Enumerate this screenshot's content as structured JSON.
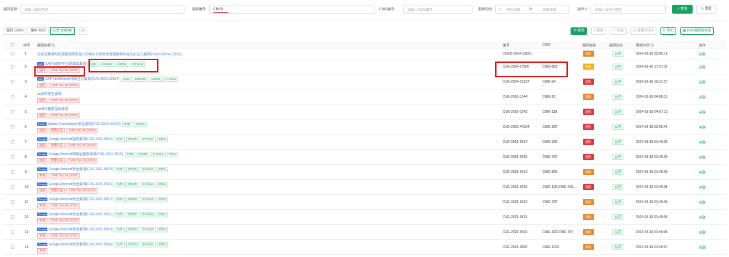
{
  "filters": {
    "name_label": "漏洞名称:",
    "name_placeholder": "请输入漏洞名称",
    "id_label": "漏洞编号:",
    "id_value": "CNVD",
    "cwe_label": "CWE编号:",
    "cwe_placeholder": "请输入CWE编号",
    "time_label": "更新时间:",
    "time_start": "开始日期",
    "time_to": "To",
    "time_end": "结束日期",
    "operator_label": "操作人:",
    "operator_placeholder": "请输入操作人姓名",
    "search_label": "查询",
    "reset_label": "重置"
  },
  "tabs": [
    {
      "label": "漏洞 13020"
    },
    {
      "label": "保存 3922"
    },
    {
      "label": "公开 264246"
    }
  ],
  "toolbar": {
    "add": "新增",
    "delete": "删除",
    "tag": "标签",
    "batch": "批量状态",
    "export": "导出",
    "import": "DPK漏洞库标签"
  },
  "columns": {
    "index": "序号",
    "name": "漏洞名称",
    "id": "编号",
    "cwe": "CWE",
    "level": "漏洞级别",
    "status": "漏洞状态",
    "time": "更新时间",
    "op": "操作"
  },
  "colors": {
    "high": "#e78a2c",
    "critical": "#d9363e",
    "medium": "#f0b416",
    "accent": "#19a15f"
  },
  "rows": [
    {
      "index": "1",
      "badge": "",
      "name": "北京亿赛通科技发展有限责任公司电子文档安全管理系统存在SQL注入漏洞(CNVD-2024-13551)",
      "sources": [],
      "tags": [],
      "id": "CNVD-2024-13551",
      "cwe": "",
      "level": "高危",
      "level_color": "high",
      "status": "公开",
      "time": "2024-03-16 23:00:15",
      "op": "关联"
    },
    {
      "index": "2",
      "badge": "SAP",
      "name": "SAP ABAP平台的跨站漏洞",
      "sources": [
        "CVE",
        "CNNVD",
        "CNVD",
        "X-Force"
      ],
      "tags": [
        "远程",
        "CWE Top 25 (2023)"
      ],
      "id": "CVE-2024-27900",
      "cwe": "CWE-862",
      "level": "中危",
      "level_color": "medium",
      "status": "公开",
      "time": "2024-03-16 17:31:35",
      "op": "关联"
    },
    {
      "index": "3",
      "badge": "SAP",
      "name": "SAP NetWeaver代码注入漏洞(CVE-2024-22127)",
      "sources": [
        "CVE",
        "CNNVD",
        "CNVD",
        "X-Force"
      ],
      "tags": [
        "远程",
        "CWE Top 25 (2023)"
      ],
      "id": "CVE-2024-22127",
      "cwe": "CWE-94",
      "level": "超危",
      "level_color": "critical",
      "status": "公开",
      "time": "2024-03-16 16:31:27",
      "op": "关联"
    },
    {
      "index": "4",
      "badge": "",
      "name": "unADF安全漏洞",
      "sources": [],
      "tags": [
        "远程",
        "CWE Top 25 (2023)"
      ],
      "id": "CVE-2016-1244",
      "cwe": "CWE-20",
      "level": "高危",
      "level_color": "high",
      "status": "公开",
      "time": "2024-03-16 04:08:11",
      "op": "关联"
    },
    {
      "index": "5",
      "badge": "",
      "name": "unADF整数溢出漏洞",
      "sources": [],
      "tags": [
        "远程",
        "CWE Top 25 (2023)"
      ],
      "id": "CVE-2016-1243",
      "cwe": "CWE-119",
      "level": "超危",
      "level_color": "critical",
      "status": "公开",
      "time": "2024-03-16 04:07:12",
      "op": "关联"
    },
    {
      "index": "6",
      "badge": "Adobe",
      "name": "Adobe FrameMaker安全漏洞(CVE-2023-44324)",
      "sources": [
        "CVE",
        "CNVD"
      ],
      "tags": [
        "远程",
        "无需认证",
        "CWE Top 25 (2023)"
      ],
      "id": "CVE-2023-44324",
      "cwe": "CWE-287",
      "level": "超危",
      "level_color": "critical",
      "status": "公开",
      "time": "2024-03-16 02:06:46",
      "op": "关联"
    },
    {
      "index": "7",
      "badge": "Google",
      "name": "Google Android提权漏洞(CVE-2021-0514)",
      "sources": [
        "CVE",
        "CNVD",
        "X-Force",
        "CISA"
      ],
      "tags": [
        "远程",
        "无需认证",
        "CWE Top 25 (2023)"
      ],
      "id": "CVE-2021-0514",
      "cwe": "CWE-362",
      "level": "超危",
      "level_color": "critical",
      "status": "公开",
      "time": "2024-03-16 01:49:06",
      "op": "关联"
    },
    {
      "index": "8",
      "badge": "Google",
      "name": "Google Android释放后重用漏洞(CVE-2021-0515)",
      "sources": [
        "CVE",
        "CNVD",
        "X-Force",
        "CISA"
      ],
      "tags": [
        "远程",
        "无需认证",
        "CWE Top 25 (2023)"
      ],
      "id": "CVE-2021-0515",
      "cwe": "CWE-787",
      "level": "超危",
      "level_color": "critical",
      "status": "公开",
      "time": "2024-03-16 01:49:06",
      "op": "关联"
    },
    {
      "index": "9",
      "badge": "Google",
      "name": "Google Android安全漏洞(CVE-2021-0513)",
      "sources": [
        "CVE",
        "CNVD",
        "X-Force",
        "CISA"
      ],
      "tags": [
        "本地",
        "CWE Top 25 (2023)"
      ],
      "id": "CVE-2021-0513",
      "cwe": "CWE-862",
      "level": "高危",
      "level_color": "high",
      "status": "公开",
      "time": "2024-03-16 01:49:06",
      "op": "关联"
    },
    {
      "index": "10",
      "badge": "Google",
      "name": "Google Android安全漏洞(CVE-2021-0516)",
      "sources": [
        "CVE",
        "CNVD",
        "X-Force",
        "CISA"
      ],
      "tags": [
        "远程",
        "无需认证",
        "CWE Top 25 (2023)"
      ],
      "id": "CVE-2021-0516",
      "cwe": "CWE-125,CWE-416,...",
      "level": "超危",
      "level_color": "critical",
      "status": "公开",
      "time": "2024-03-16 01:49:08",
      "op": "关联"
    },
    {
      "index": "11",
      "badge": "Google",
      "name": "Google Android安全漏洞(CVE-2021-0512)",
      "sources": [
        "CVE",
        "CNVD",
        "X-Force",
        "CISA"
      ],
      "tags": [
        "本地",
        "CWE Top 25 (2023)"
      ],
      "id": "CVE-2021-0512",
      "cwe": "CWE-787",
      "level": "高危",
      "level_color": "high",
      "status": "公开",
      "time": "2024-03-16 01:49:06",
      "op": "关联"
    },
    {
      "index": "12",
      "badge": "Google",
      "name": "Google Android安全漏洞(CVE-2021-0511)",
      "sources": [
        "CVE",
        "CNVD",
        "X-Force",
        "CISA"
      ],
      "tags": [
        "本地",
        "CWE Top 25 (2023)"
      ],
      "id": "CVE-2021-0511",
      "cwe": "",
      "level": "高危",
      "level_color": "high",
      "status": "公开",
      "time": "2024-03-16 01:49:06",
      "op": "关联"
    },
    {
      "index": "13",
      "badge": "Google",
      "name": "Google Android安全漏洞(CVE-2021-0510)",
      "sources": [
        "CVE",
        "CNVD",
        "X-Force",
        "CISA"
      ],
      "tags": [
        "本地",
        "CWE Top 25 (2023)"
      ],
      "id": "CVE-2021-0510",
      "cwe": "CWE-190,CWE-787",
      "level": "高危",
      "level_color": "high",
      "status": "公开",
      "time": "2024-03-16 01:49:06",
      "op": "关联"
    },
    {
      "index": "14",
      "badge": "Google",
      "name": "Google Android安全漏洞(CVE-2021-0506)",
      "sources": [
        "CVE",
        "CNVD",
        "X-Force",
        "CISA"
      ],
      "tags": [
        "本地"
      ],
      "id": "CVE-2021-0506",
      "cwe": "CWE-1021",
      "level": "高危",
      "level_color": "high",
      "status": "公开",
      "time": "2024-03-16 01:49:07",
      "op": "关联"
    }
  ]
}
